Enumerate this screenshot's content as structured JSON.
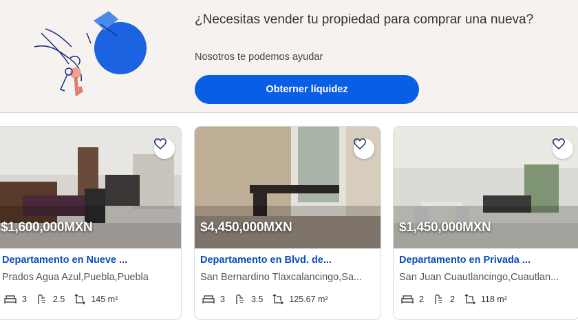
{
  "banner": {
    "title": "¿Necesitas vender tu propiedad para comprar una nueva?",
    "subtitle": "Nosotros te podemos ayudar",
    "cta_label": "Obterner líquidez"
  },
  "colors": {
    "primary": "#0a5ee6",
    "title_link": "#0a4bbf",
    "banner_bg": "#f6f2ef"
  },
  "icons": {
    "favorite": "heart-outline-icon",
    "bedrooms": "bed-icon",
    "bathrooms": "shower-icon",
    "area": "area-icon"
  },
  "listings": [
    {
      "price": "$1,600,000MXN",
      "title": "Departamento en Nueve ...",
      "location": "Prados Agua Azul,Puebla,Puebla",
      "bedrooms": "3",
      "bathrooms": "2.5",
      "area": "145 m²"
    },
    {
      "price": "$4,450,000MXN",
      "title": "Departamento en Blvd. de...",
      "location": "San Bernardino Tlaxcalancingo,Sa...",
      "bedrooms": "3",
      "bathrooms": "3.5",
      "area": "125.67 m²"
    },
    {
      "price": "$1,450,000MXN",
      "title": "Departamento en Privada ...",
      "location": "San Juan Cuautlancingo,Cuautlan...",
      "bedrooms": "2",
      "bathrooms": "2",
      "area": "118 m²"
    }
  ]
}
